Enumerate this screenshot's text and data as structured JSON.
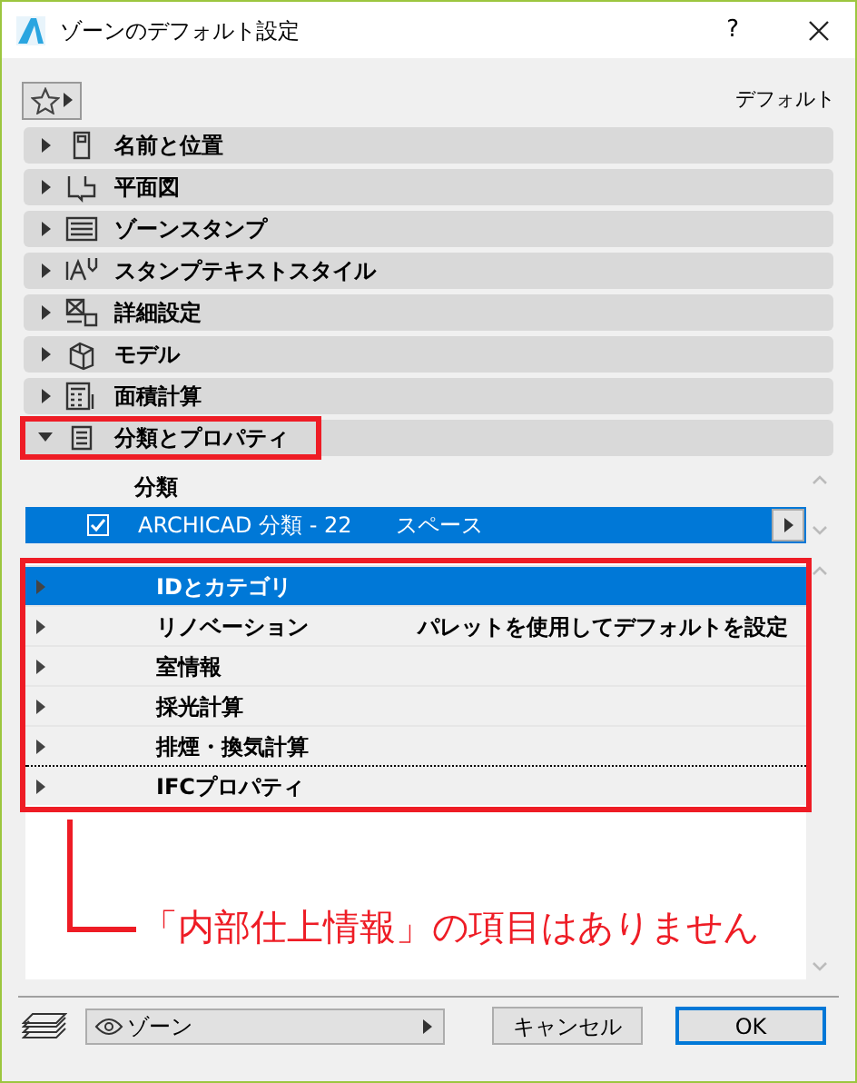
{
  "window": {
    "title": "ゾーンのデフォルト設定",
    "help": "?"
  },
  "toolbar": {
    "preset_label": "デフォルト"
  },
  "sections": [
    {
      "label": "名前と位置",
      "expanded": false,
      "highlighted": false
    },
    {
      "label": "平面図",
      "expanded": false,
      "highlighted": false
    },
    {
      "label": "ゾーンスタンプ",
      "expanded": false,
      "highlighted": false
    },
    {
      "label": "スタンプテキストスタイル",
      "expanded": false,
      "highlighted": false
    },
    {
      "label": "詳細設定",
      "expanded": false,
      "highlighted": false
    },
    {
      "label": "モデル",
      "expanded": false,
      "highlighted": false
    },
    {
      "label": "面積計算",
      "expanded": false,
      "highlighted": false
    },
    {
      "label": "分類とプロパティ",
      "expanded": true,
      "highlighted": true
    }
  ],
  "classification": {
    "header": "分類",
    "rows": [
      {
        "checked": true,
        "system": "ARCHICAD 分類 - 22",
        "value": "スペース",
        "selected": true
      }
    ]
  },
  "properties": [
    {
      "label": "IDとカテゴリ",
      "selected": true,
      "divider_before": false
    },
    {
      "label": "リノベーション",
      "value": "パレットを使用してデフォルトを設定",
      "selected": false,
      "divider_before": false
    },
    {
      "label": "室情報",
      "selected": false,
      "divider_before": false
    },
    {
      "label": "採光計算",
      "selected": false,
      "divider_before": false
    },
    {
      "label": "排煙・換気計算",
      "selected": false,
      "divider_before": false
    },
    {
      "label": "IFCプロパティ",
      "selected": false,
      "divider_before": true
    }
  ],
  "annotation": {
    "text": "「内部仕上情報」の項目はありません"
  },
  "footer": {
    "layer": "ゾーン",
    "cancel": "キャンセル",
    "ok": "OK"
  }
}
